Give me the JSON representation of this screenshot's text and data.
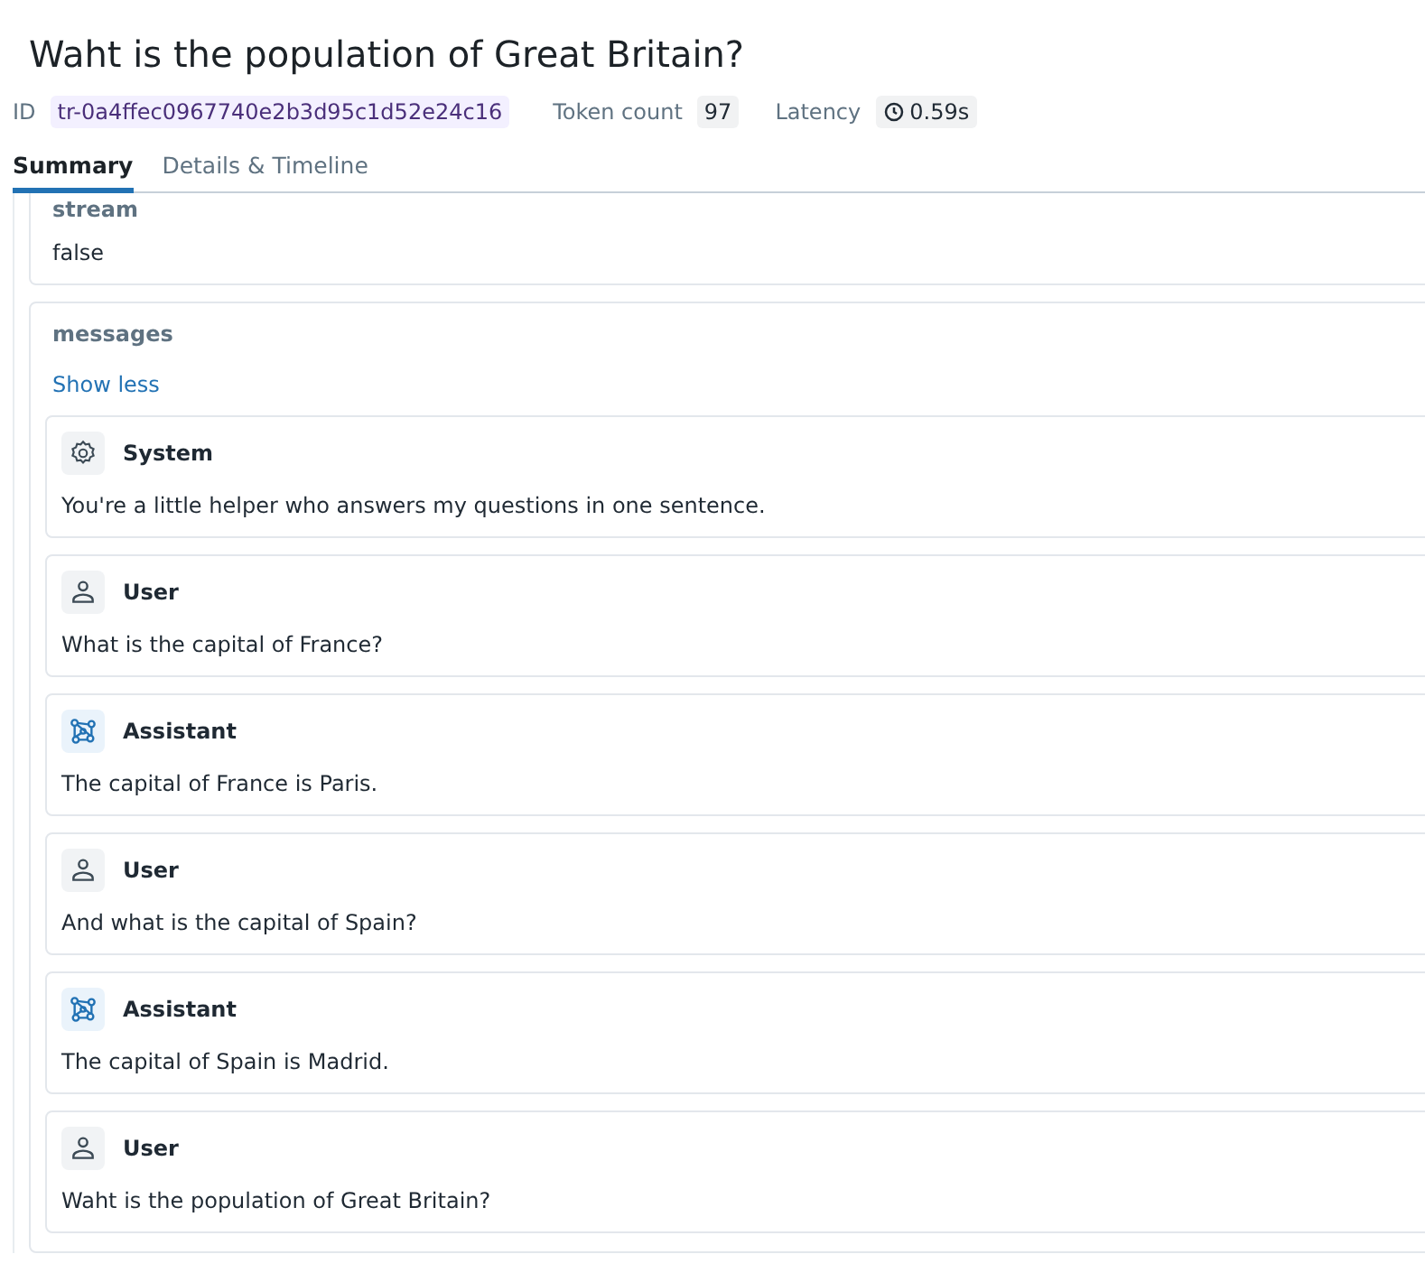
{
  "title": "Waht is the population of Great Britain?",
  "meta": {
    "id_label": "ID",
    "id": "tr-0a4ffec0967740e2b3d95c1d52e24c16",
    "token_label": "Token count",
    "token_count": "97",
    "latency_label": "Latency",
    "latency": "0.59s"
  },
  "tabs": [
    {
      "label": "Summary",
      "selected": true
    },
    {
      "label": "Details & Timeline",
      "selected": false
    }
  ],
  "fields": [
    {
      "kind": "value",
      "name": "stream",
      "value": "false"
    },
    {
      "kind": "messages",
      "name": "messages",
      "toggle": "Show less",
      "messages": [
        {
          "kind": "system",
          "role": "System",
          "text": "You're a little helper who answers my questions in one sentence."
        },
        {
          "kind": "user",
          "role": "User",
          "text": "What is the capital of France?"
        },
        {
          "kind": "assistant",
          "role": "Assistant",
          "text": "The capital of France is Paris."
        },
        {
          "kind": "user",
          "role": "User",
          "text": "And what is the capital of Spain?"
        },
        {
          "kind": "assistant",
          "role": "Assistant",
          "text": "The capital of Spain is Madrid."
        },
        {
          "kind": "user",
          "role": "User",
          "text": "Waht is the population of Great Britain?"
        }
      ]
    }
  ]
}
